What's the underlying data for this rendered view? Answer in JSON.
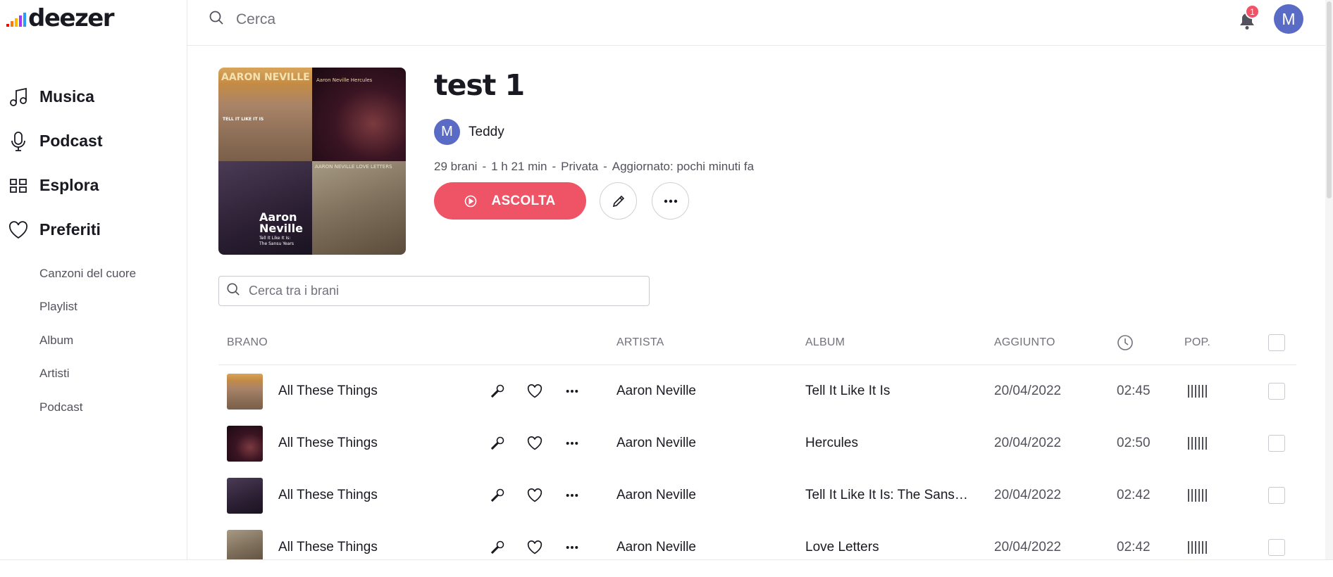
{
  "app": {
    "logo_text": "deezer",
    "brand_color": "#ef5466",
    "logo_bar_colors": [
      "#ff0000",
      "#ff7a00",
      "#ffb800",
      "#a238ff",
      "#2a9df4"
    ]
  },
  "sidebar": {
    "nav": [
      {
        "label": "Musica",
        "icon": "music-note-icon"
      },
      {
        "label": "Podcast",
        "icon": "microphone-icon"
      },
      {
        "label": "Esplora",
        "icon": "grid-icon"
      },
      {
        "label": "Preferiti",
        "icon": "heart-icon"
      }
    ],
    "sub": [
      "Canzoni del cuore",
      "Playlist",
      "Album",
      "Artisti",
      "Podcast"
    ]
  },
  "topbar": {
    "search_placeholder": "Cerca",
    "notification_count": "1",
    "avatar_initial": "M"
  },
  "playlist": {
    "title": "test 1",
    "owner_initial": "M",
    "owner": "Teddy",
    "meta": [
      "29 brani",
      "-",
      "1 h 21 min",
      "-",
      "Privata",
      "-",
      "Aggiornato: pochi minuti fa"
    ],
    "play_label": "ASCOLTA",
    "cover_texts": {
      "q1": "AARON NEVILLE",
      "q1_sub": "TELL IT LIKE IT IS",
      "q2": "Aaron Neville Hercules",
      "q3_a": "Aaron",
      "q3_b": "Neville",
      "q3_c": "Tell It Like It Is:",
      "q3_d": "The Sansu Years",
      "q4": "AARON NEVILLE LOVE LETTERS"
    }
  },
  "track_search": {
    "placeholder": "Cerca tra i brani"
  },
  "table": {
    "headers": {
      "track": "BRANO",
      "artist": "ARTISTA",
      "album": "ALBUM",
      "added": "AGGIUNTO",
      "pop": "POP."
    },
    "rows": [
      {
        "title": "All These Things",
        "artist": "Aaron Neville",
        "album": "Tell It Like It Is",
        "added": "20/04/2022",
        "duration": "02:45",
        "popularity": 1.0,
        "thumb": "q1"
      },
      {
        "title": "All These Things",
        "artist": "Aaron Neville",
        "album": "Hercules",
        "added": "20/04/2022",
        "duration": "02:50",
        "popularity": 1.0,
        "thumb": "q2"
      },
      {
        "title": "All These Things",
        "artist": "Aaron Neville",
        "album": "Tell It Like It Is: The Sans…",
        "added": "20/04/2022",
        "duration": "02:42",
        "popularity": 1.0,
        "thumb": "q3"
      },
      {
        "title": "All These Things",
        "artist": "Aaron Neville",
        "album": "Love Letters",
        "added": "20/04/2022",
        "duration": "02:42",
        "popularity": 1.0,
        "thumb": "q4"
      }
    ]
  }
}
